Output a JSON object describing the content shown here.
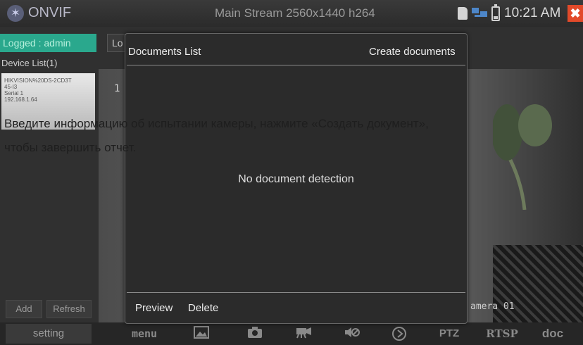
{
  "status_bar": {
    "app_name": "ONVIF",
    "stream_title": "Main Stream 2560x1440 h264",
    "time": "10:21 AM",
    "app_icon": "onvif-logo-icon",
    "icons": [
      "sd-card-icon",
      "network-icon",
      "battery-icon",
      "close-icon"
    ],
    "close_color": "#e24a2a"
  },
  "left_panel": {
    "logged_label": "Logged : admin",
    "device_list_label": "Device List(1)",
    "device": {
      "name_line1": "HIKVISION%20DS-2CD3T",
      "name_line2": "45-I3",
      "serial": "Serial 1",
      "ip": "192.168.1.64"
    },
    "add_label": "Add",
    "refresh_label": "Refresh",
    "accent_color": "#2aa88d"
  },
  "video": {
    "stub_tab_label": "Lo",
    "stream_number": "1",
    "camera_label": "amera 01"
  },
  "caption": {
    "line1": "Введите информацию об испытании камеры, нажмите «Создать документ»,",
    "line2": "чтобы завершить отчет."
  },
  "modal": {
    "title": "Documents List",
    "create_label": "Create documents",
    "empty_message": "No document detection",
    "preview_label": "Preview",
    "delete_label": "Delete"
  },
  "bottom_bar": {
    "setting_label": "setting",
    "menu_label": "menu",
    "ptz_label": "PTZ",
    "rtsp_label": "RTSP",
    "doc_label": "doc",
    "icons": [
      "image-icon",
      "camera-icon",
      "video-record-icon",
      "mute-icon",
      "play-icon"
    ]
  }
}
